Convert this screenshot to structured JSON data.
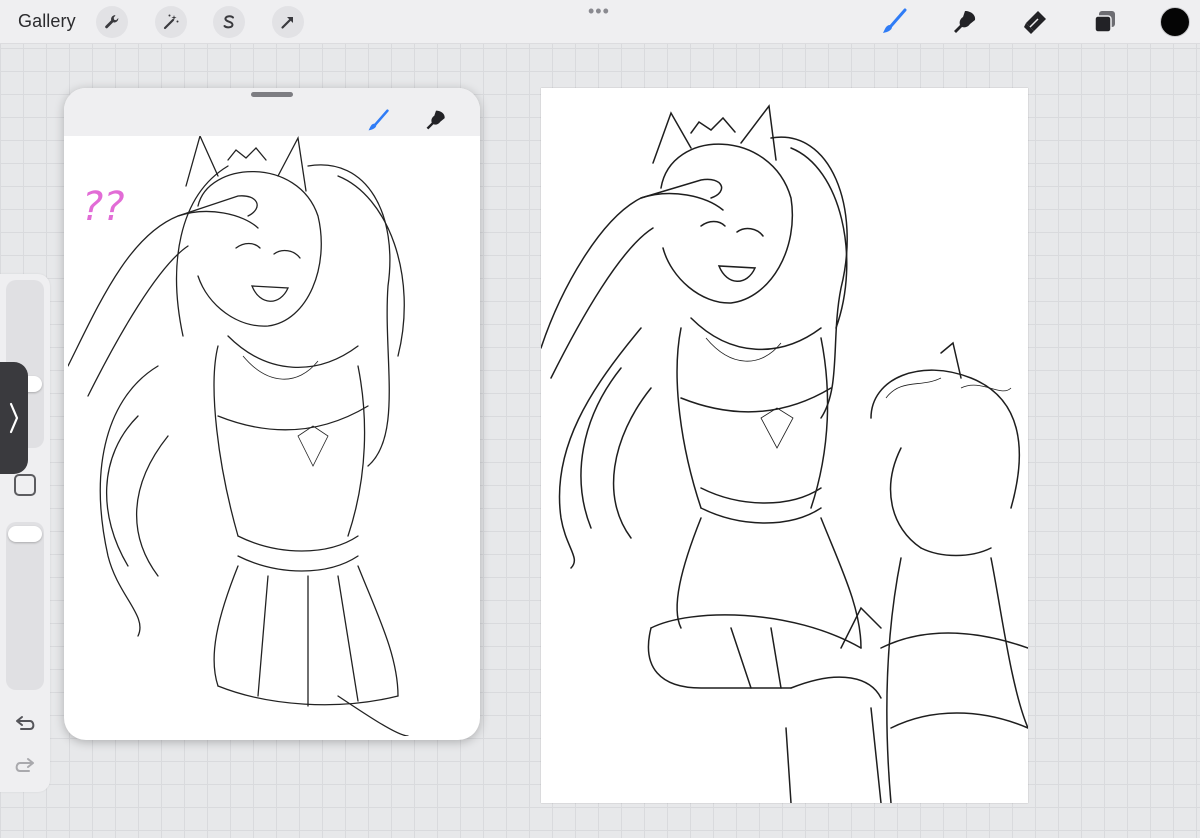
{
  "topbar": {
    "gallery_label": "Gallery",
    "left_tools": [
      "wrench-icon",
      "magic-wand-icon",
      "selection-s-icon",
      "transform-arrow-icon"
    ],
    "right_tools": [
      "brush-icon",
      "smudge-icon",
      "eraser-icon",
      "layers-icon"
    ],
    "active_tool": "brush-icon",
    "accent_color": "#2f7cf6",
    "current_color": "#050505"
  },
  "sidebar": {
    "brush_size": 0.4,
    "opacity": 1.0,
    "tools": [
      "chevron-right-icon",
      "modify-square-icon",
      "undo-icon",
      "redo-icon"
    ]
  },
  "reference_window": {
    "tools": [
      "brush-icon",
      "smudge-icon"
    ],
    "annotation_text": "??",
    "annotation_color": "#e26cd6"
  }
}
